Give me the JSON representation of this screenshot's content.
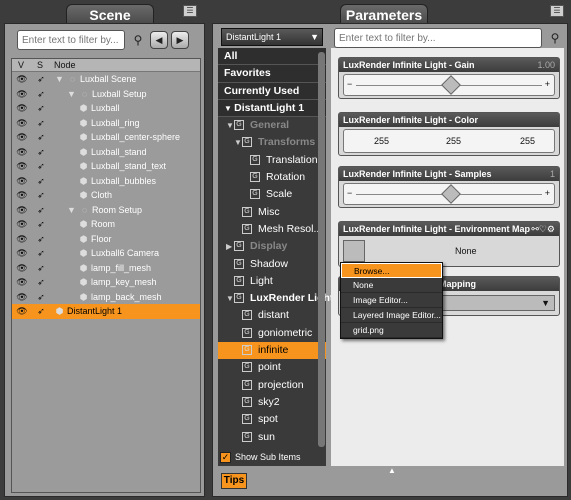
{
  "scene": {
    "title": "Scene",
    "search_placeholder": "Enter text to filter by...",
    "columns": {
      "v": "V",
      "s": "S",
      "node": "Node"
    },
    "nodes": [
      {
        "label": "Luxball Scene",
        "indent": 0,
        "twisty": "▼"
      },
      {
        "label": "Luxball Setup",
        "indent": 1,
        "twisty": "▼"
      },
      {
        "label": "Luxball",
        "indent": 2
      },
      {
        "label": "Luxball_ring",
        "indent": 2
      },
      {
        "label": "Luxball_center-sphere",
        "indent": 2
      },
      {
        "label": "Luxball_stand",
        "indent": 2
      },
      {
        "label": "Luxball_stand_text",
        "indent": 2
      },
      {
        "label": "Luxball_bubbles",
        "indent": 2
      },
      {
        "label": "Cloth",
        "indent": 2
      },
      {
        "label": "Room Setup",
        "indent": 1,
        "twisty": "▼"
      },
      {
        "label": "Room",
        "indent": 2
      },
      {
        "label": "Floor",
        "indent": 2
      },
      {
        "label": "Luxball6 Camera",
        "indent": 2
      },
      {
        "label": "lamp_fill_mesh",
        "indent": 2
      },
      {
        "label": "lamp_key_mesh",
        "indent": 2
      },
      {
        "label": "lamp_back_mesh",
        "indent": 2
      },
      {
        "label": "DistantLight 1",
        "indent": 0,
        "active": true
      }
    ]
  },
  "params": {
    "title": "Parameters",
    "search_placeholder": "Enter text to filter by...",
    "node_select": "DistantLight 1",
    "categories": [
      {
        "label": "All",
        "type": "hdr"
      },
      {
        "label": "Favorites",
        "type": "hdr"
      },
      {
        "label": "Currently Used",
        "type": "hdr"
      },
      {
        "label": "DistantLight 1",
        "type": "hdr",
        "twisty": "▼"
      },
      {
        "label": "General",
        "type": "grey",
        "indent": 1,
        "twisty": "▼"
      },
      {
        "label": "Transforms",
        "type": "grey",
        "indent": 2,
        "twisty": "▼"
      },
      {
        "label": "Translation",
        "indent": 3
      },
      {
        "label": "Rotation",
        "indent": 3
      },
      {
        "label": "Scale",
        "indent": 3
      },
      {
        "label": "Misc",
        "indent": 2
      },
      {
        "label": "Mesh Resol...",
        "indent": 2
      },
      {
        "label": "Display",
        "type": "grey",
        "indent": 1,
        "twisty": "▶"
      },
      {
        "label": "Shadow",
        "indent": 1
      },
      {
        "label": "Light",
        "indent": 1
      },
      {
        "label": "LuxRender Light",
        "type": "bold",
        "indent": 1,
        "twisty": "▼"
      },
      {
        "label": "distant",
        "indent": 2
      },
      {
        "label": "goniometric",
        "indent": 2
      },
      {
        "label": "infinite",
        "indent": 2,
        "active": true
      },
      {
        "label": "point",
        "indent": 2
      },
      {
        "label": "projection",
        "indent": 2
      },
      {
        "label": "sky2",
        "indent": 2
      },
      {
        "label": "spot",
        "indent": 2
      },
      {
        "label": "sun",
        "indent": 2
      }
    ],
    "show_sub_items": "Show Sub Items",
    "gain": {
      "title": "LuxRender Infinite Light - Gain",
      "value": "1.00"
    },
    "color": {
      "title": "LuxRender Infinite Light - Color",
      "r": "255",
      "g": "255",
      "b": "255"
    },
    "samples": {
      "title": "LuxRender Infinite Light - Samples",
      "value": "1"
    },
    "envmap": {
      "title": "LuxRender Infinite Light - Environment Map",
      "value": "None"
    },
    "mapping_title": "Mapping",
    "menu": [
      "Browse...",
      "None",
      "Image Editor...",
      "Layered Image Editor...",
      "grid.png"
    ],
    "tips": "Tips"
  },
  "colors": {
    "accent": "#f7941d",
    "panel": "#9a9a9a",
    "dark": "#3a3a3a"
  }
}
